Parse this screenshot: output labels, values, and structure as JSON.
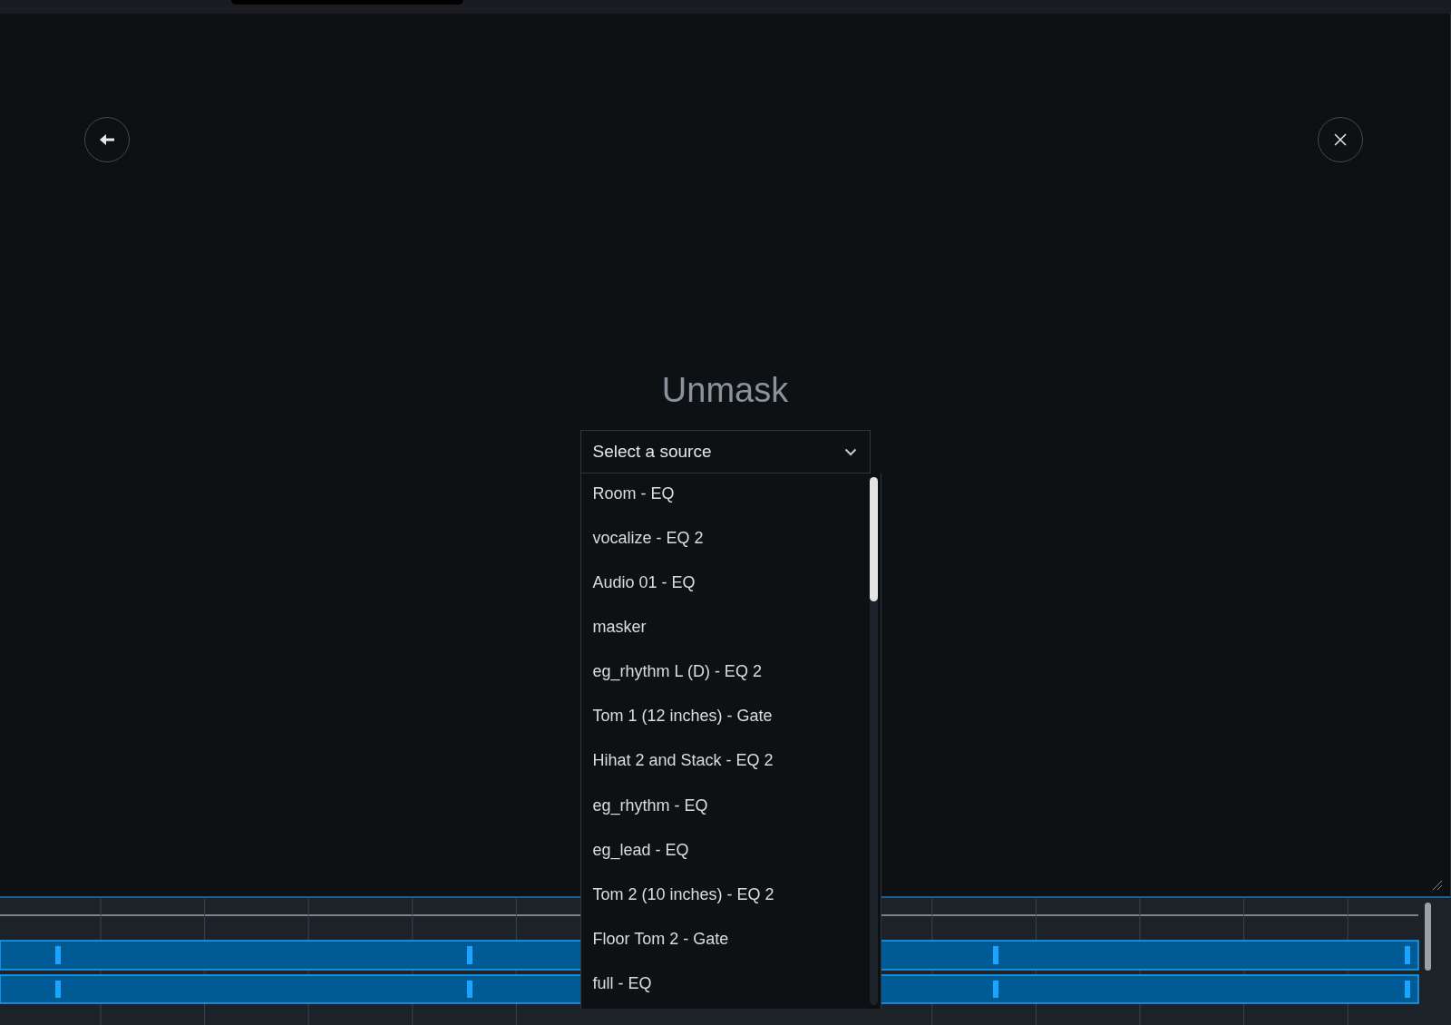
{
  "dialog": {
    "title": "Unmask"
  },
  "source_select": {
    "placeholder": "Select a source",
    "expanded": true,
    "options": [
      {
        "label": "Room - EQ",
        "selected": false
      },
      {
        "label": "vocalize - EQ 2",
        "selected": false
      },
      {
        "label": "Audio 01 - EQ",
        "selected": false
      },
      {
        "label": "masker",
        "selected": false
      },
      {
        "label": "eg_rhythm L (D) - EQ 2",
        "selected": false
      },
      {
        "label": "Tom 1 (12 inches) - Gate",
        "selected": false
      },
      {
        "label": "Hihat 2 and Stack - EQ 2",
        "selected": false
      },
      {
        "label": "eg_rhythm - EQ",
        "selected": false
      },
      {
        "label": "eg_lead - EQ",
        "selected": false
      },
      {
        "label": "Tom 2 (10 inches) - EQ 2",
        "selected": false
      },
      {
        "label": "Floor Tom 2 - Gate",
        "selected": false
      },
      {
        "label": "full - EQ",
        "selected": false
      }
    ]
  }
}
